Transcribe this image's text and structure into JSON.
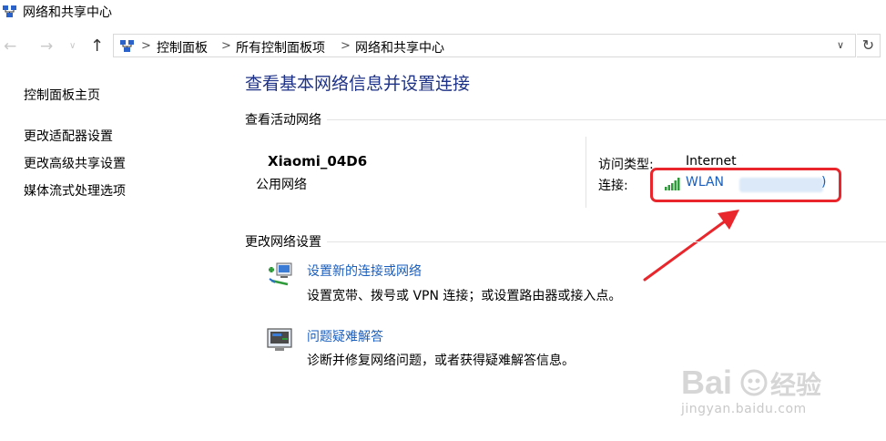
{
  "window": {
    "title": "网络和共享中心"
  },
  "nav": {
    "back_glyph": "←",
    "forward_glyph": "→",
    "recent_glyph": "∨",
    "up_glyph": "↑",
    "breadcrumb": [
      "控制面板",
      "所有控制面板项",
      "网络和共享中心"
    ],
    "separator": ">",
    "dropdown_glyph": "∨",
    "refresh_glyph": "↻"
  },
  "sidebar": {
    "items": [
      {
        "label": "控制面板主页"
      },
      {
        "label": "更改适配器设置"
      },
      {
        "label": "更改高级共享设置"
      },
      {
        "label": "媒体流式处理选项"
      }
    ]
  },
  "main": {
    "title": "查看基本网络信息并设置连接",
    "active_section": "查看活动网络",
    "network": {
      "name": "Xiaomi_04D6",
      "type": "公用网络",
      "access_label": "访问类型:",
      "access_value": "Internet",
      "connection_label": "连接:",
      "connection_link": "WLAN",
      "connection_suffix": ")"
    },
    "change_section": "更改网络设置",
    "tasks": [
      {
        "link": "设置新的连接或网络",
        "description": "设置宽带、拨号或 VPN 连接；或设置路由器或接入点。",
        "icon": "network-setup-icon"
      },
      {
        "link": "问题疑难解答",
        "description": "诊断并修复网络问题，或者获得疑难解答信息。",
        "icon": "troubleshoot-icon"
      }
    ]
  },
  "colors": {
    "link": "#1a5ebd",
    "title": "#1e3287",
    "annotation": "#e8262c"
  },
  "watermark": {
    "url": "jingyan.baidu.com"
  }
}
